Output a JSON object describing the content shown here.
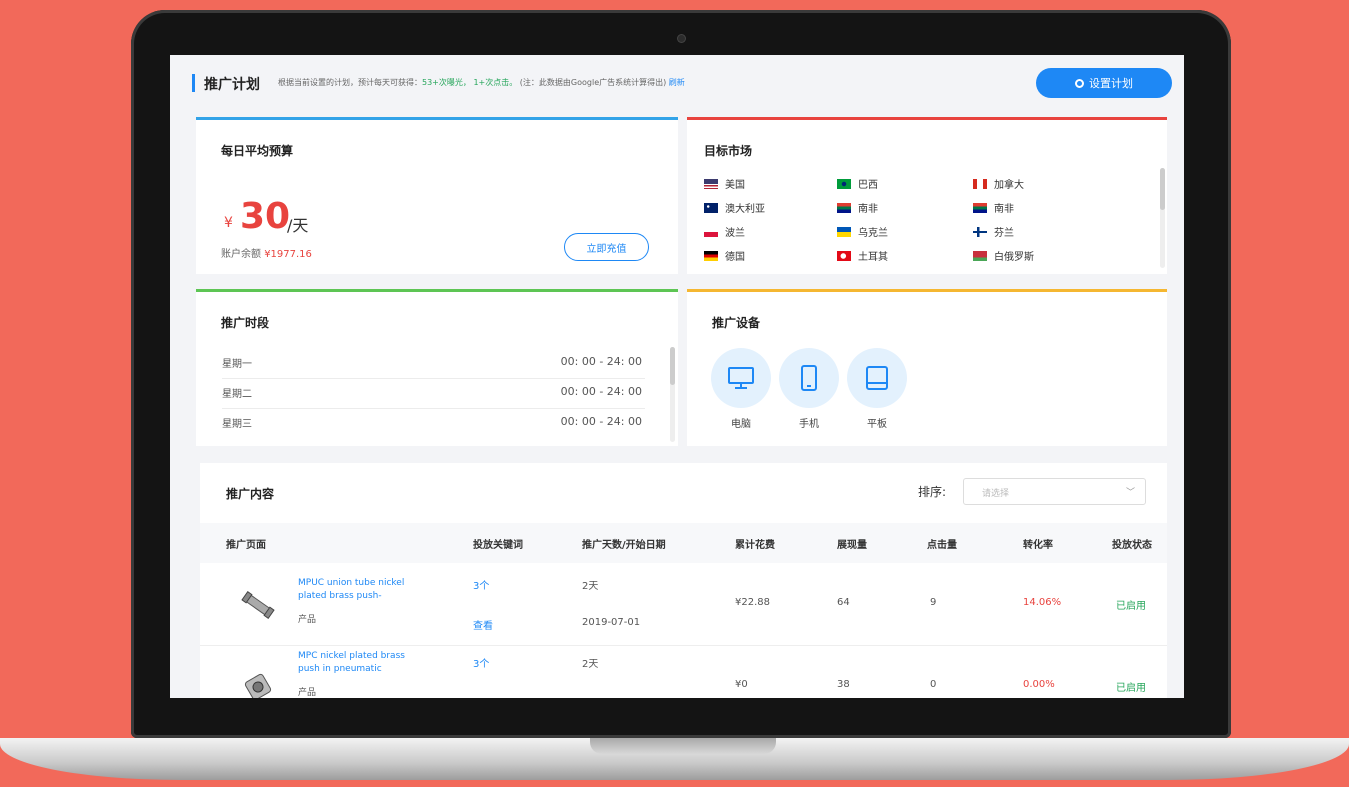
{
  "header": {
    "title": "推广计划",
    "hint_prefix": "根据当前设置的计划，预计每天可获得：",
    "hint_impressions": "53+次曝光，",
    "hint_clicks": "1+次点击。",
    "hint_note": "(注：此数据由Google广告系统计算得出)",
    "hint_refresh": "刷新",
    "set_plan_label": "设置计划"
  },
  "budget": {
    "title": "每日平均预算",
    "currency": "¥",
    "amount": "30",
    "unit": "/天",
    "balance_label": "账户余额",
    "balance_value": "¥1977.16",
    "recharge_label": "立即充值"
  },
  "markets": {
    "title": "目标市场",
    "items": [
      {
        "name": "美国",
        "flag": "us-flag"
      },
      {
        "name": "巴西",
        "flag": "brazil-flag"
      },
      {
        "name": "加拿大",
        "flag": "canada-flag"
      },
      {
        "name": "澳大利亚",
        "flag": "australia-flag"
      },
      {
        "name": "南非",
        "flag": "south-africa-flag"
      },
      {
        "name": "南非",
        "flag": "south-africa-flag"
      },
      {
        "name": "波兰",
        "flag": "poland-flag"
      },
      {
        "name": "乌克兰",
        "flag": "ukraine-flag"
      },
      {
        "name": "芬兰",
        "flag": "finland-flag"
      },
      {
        "name": "德国",
        "flag": "germany-flag"
      },
      {
        "name": "土耳其",
        "flag": "turkey-flag"
      },
      {
        "name": "白俄罗斯",
        "flag": "belarus-flag"
      }
    ]
  },
  "schedule": {
    "title": "推广时段",
    "rows": [
      {
        "day": "星期一",
        "time": "00: 00 - 24: 00"
      },
      {
        "day": "星期二",
        "time": "00: 00 - 24: 00"
      },
      {
        "day": "星期三",
        "time": "00: 00 - 24: 00"
      }
    ]
  },
  "devices": {
    "title": "推广设备",
    "items": [
      {
        "label": "电脑",
        "icon": "desktop-icon"
      },
      {
        "label": "手机",
        "icon": "mobile-icon"
      },
      {
        "label": "平板",
        "icon": "tablet-icon"
      }
    ]
  },
  "content": {
    "title": "推广内容",
    "sort_label": "排序:",
    "sort_placeholder": "请选择",
    "columns": [
      "推广页面",
      "投放关键词",
      "推广天数/开始日期",
      "累计花费",
      "展现量",
      "点击量",
      "转化率",
      "投放状态"
    ],
    "rows": [
      {
        "page": "MPUC union tube nickel plated brass push-",
        "type": "产品",
        "keywords": "3个",
        "view": "查看",
        "days": "2天",
        "date": "2019-07-01",
        "cost": "¥22.88",
        "impressions": "64",
        "clicks": "9",
        "rate": "14.06%",
        "status": "已启用"
      },
      {
        "page": "MPC nickel plated brass push in pneumatic",
        "type": "产品",
        "keywords": "3个",
        "days": "2天",
        "cost": "¥0",
        "impressions": "38",
        "clicks": "0",
        "rate": "0.00%",
        "status": "已启用"
      }
    ]
  },
  "colors": {
    "accent": "#1E88F5",
    "danger": "#E8433E",
    "success": "#26A65B",
    "background": "#F2695A"
  }
}
